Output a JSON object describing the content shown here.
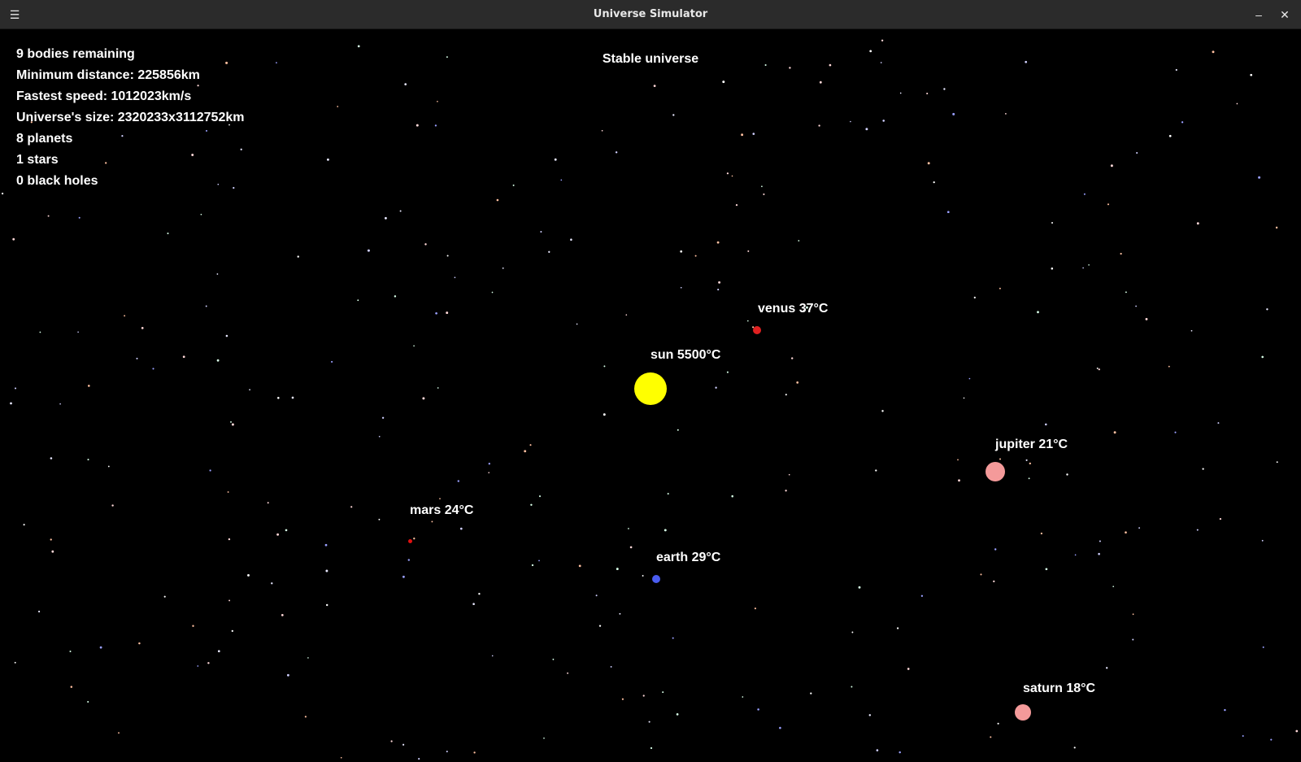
{
  "window": {
    "title": "Universe Simulator",
    "menu_icon": "hamburger-menu-icon",
    "minimize_icon": "minimize-icon",
    "close_icon": "close-icon"
  },
  "stats": {
    "bodies": "9 bodies remaining",
    "min_distance": "Minimum distance: 225856km",
    "fastest_speed": "Fastest speed: 1012023km/s",
    "universe_size": "Universe's size: 2320233x3112752km",
    "planets": "8 planets",
    "stars": "1 stars",
    "black_holes": "0 black holes"
  },
  "status": "Stable universe",
  "bodies": {
    "sun": {
      "label": "sun 5500°C",
      "color": "#ffff00"
    },
    "venus": {
      "label": "venus 37°C",
      "color": "#e02020"
    },
    "earth": {
      "label": "earth 29°C",
      "color": "#4a5cf0"
    },
    "mars": {
      "label": "mars 24°C",
      "color": "#e01010"
    },
    "jupiter": {
      "label": "jupiter 21°C",
      "color": "#f49a9a"
    },
    "saturn": {
      "label": "saturn 18°C",
      "color": "#f49a9a"
    }
  },
  "colors": {
    "background": "#000000",
    "titlebar": "#2b2b2b",
    "text": "#ffffff"
  }
}
